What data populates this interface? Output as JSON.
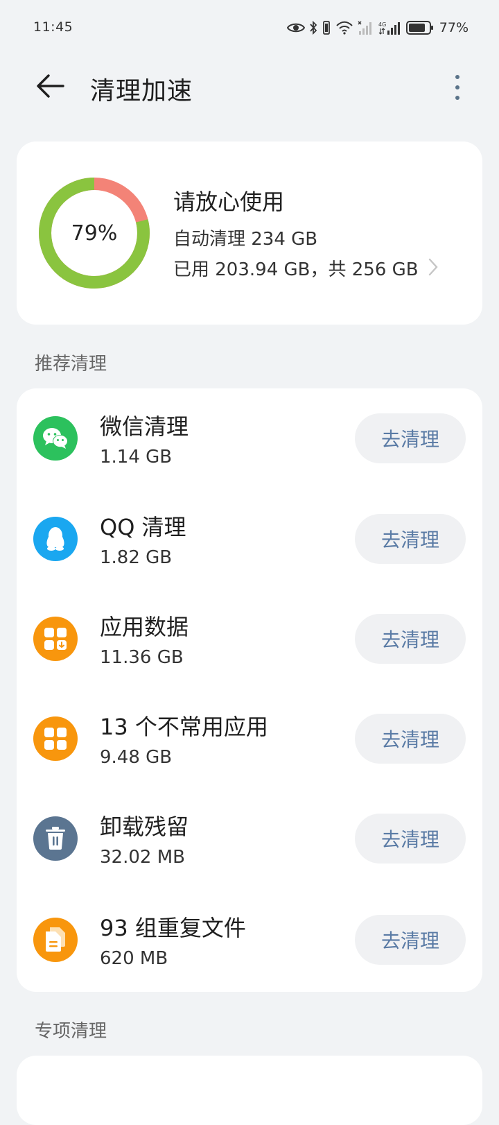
{
  "status_bar": {
    "time": "11:45",
    "battery_percent": "77%",
    "icons": [
      "eye-icon",
      "bluetooth-icon",
      "vibrate-icon",
      "wifi-icon",
      "signal-icon",
      "signal-4g-icon",
      "battery-icon"
    ]
  },
  "header": {
    "title": "清理加速",
    "back_icon": "arrow-left-icon",
    "more_icon": "more-vertical-icon"
  },
  "storage": {
    "percent_label": "79%",
    "used_fraction": 0.79,
    "status": "请放心使用",
    "auto_clean": "自动清理 234 GB",
    "used_summary": "已用 203.94 GB，共 256 GB",
    "colors": {
      "ring_used": "#8ac43f",
      "ring_alert": "#f38377"
    }
  },
  "recommended": {
    "title": "推荐清理",
    "items": [
      {
        "icon": "wechat-icon",
        "color": "#2cc15d",
        "title": "微信清理",
        "size": "1.14 GB",
        "button": "去清理"
      },
      {
        "icon": "qq-icon",
        "color": "#1aa7f0",
        "title": "QQ 清理",
        "size": "1.82 GB",
        "button": "去清理"
      },
      {
        "icon": "app-data-icon",
        "color": "#f8960d",
        "title": "应用数据",
        "size": "11.36 GB",
        "button": "去清理"
      },
      {
        "icon": "apps-grid-icon",
        "color": "#f8960d",
        "title": "13 个不常用应用",
        "size": "9.48 GB",
        "button": "去清理"
      },
      {
        "icon": "trash-icon",
        "color": "#5b7591",
        "title": "卸载残留",
        "size": "32.02 MB",
        "button": "去清理"
      },
      {
        "icon": "duplicate-file-icon",
        "color": "#f8960d",
        "title": "93 组重复文件",
        "size": "620 MB",
        "button": "去清理"
      }
    ]
  },
  "special": {
    "title": "专项清理"
  }
}
